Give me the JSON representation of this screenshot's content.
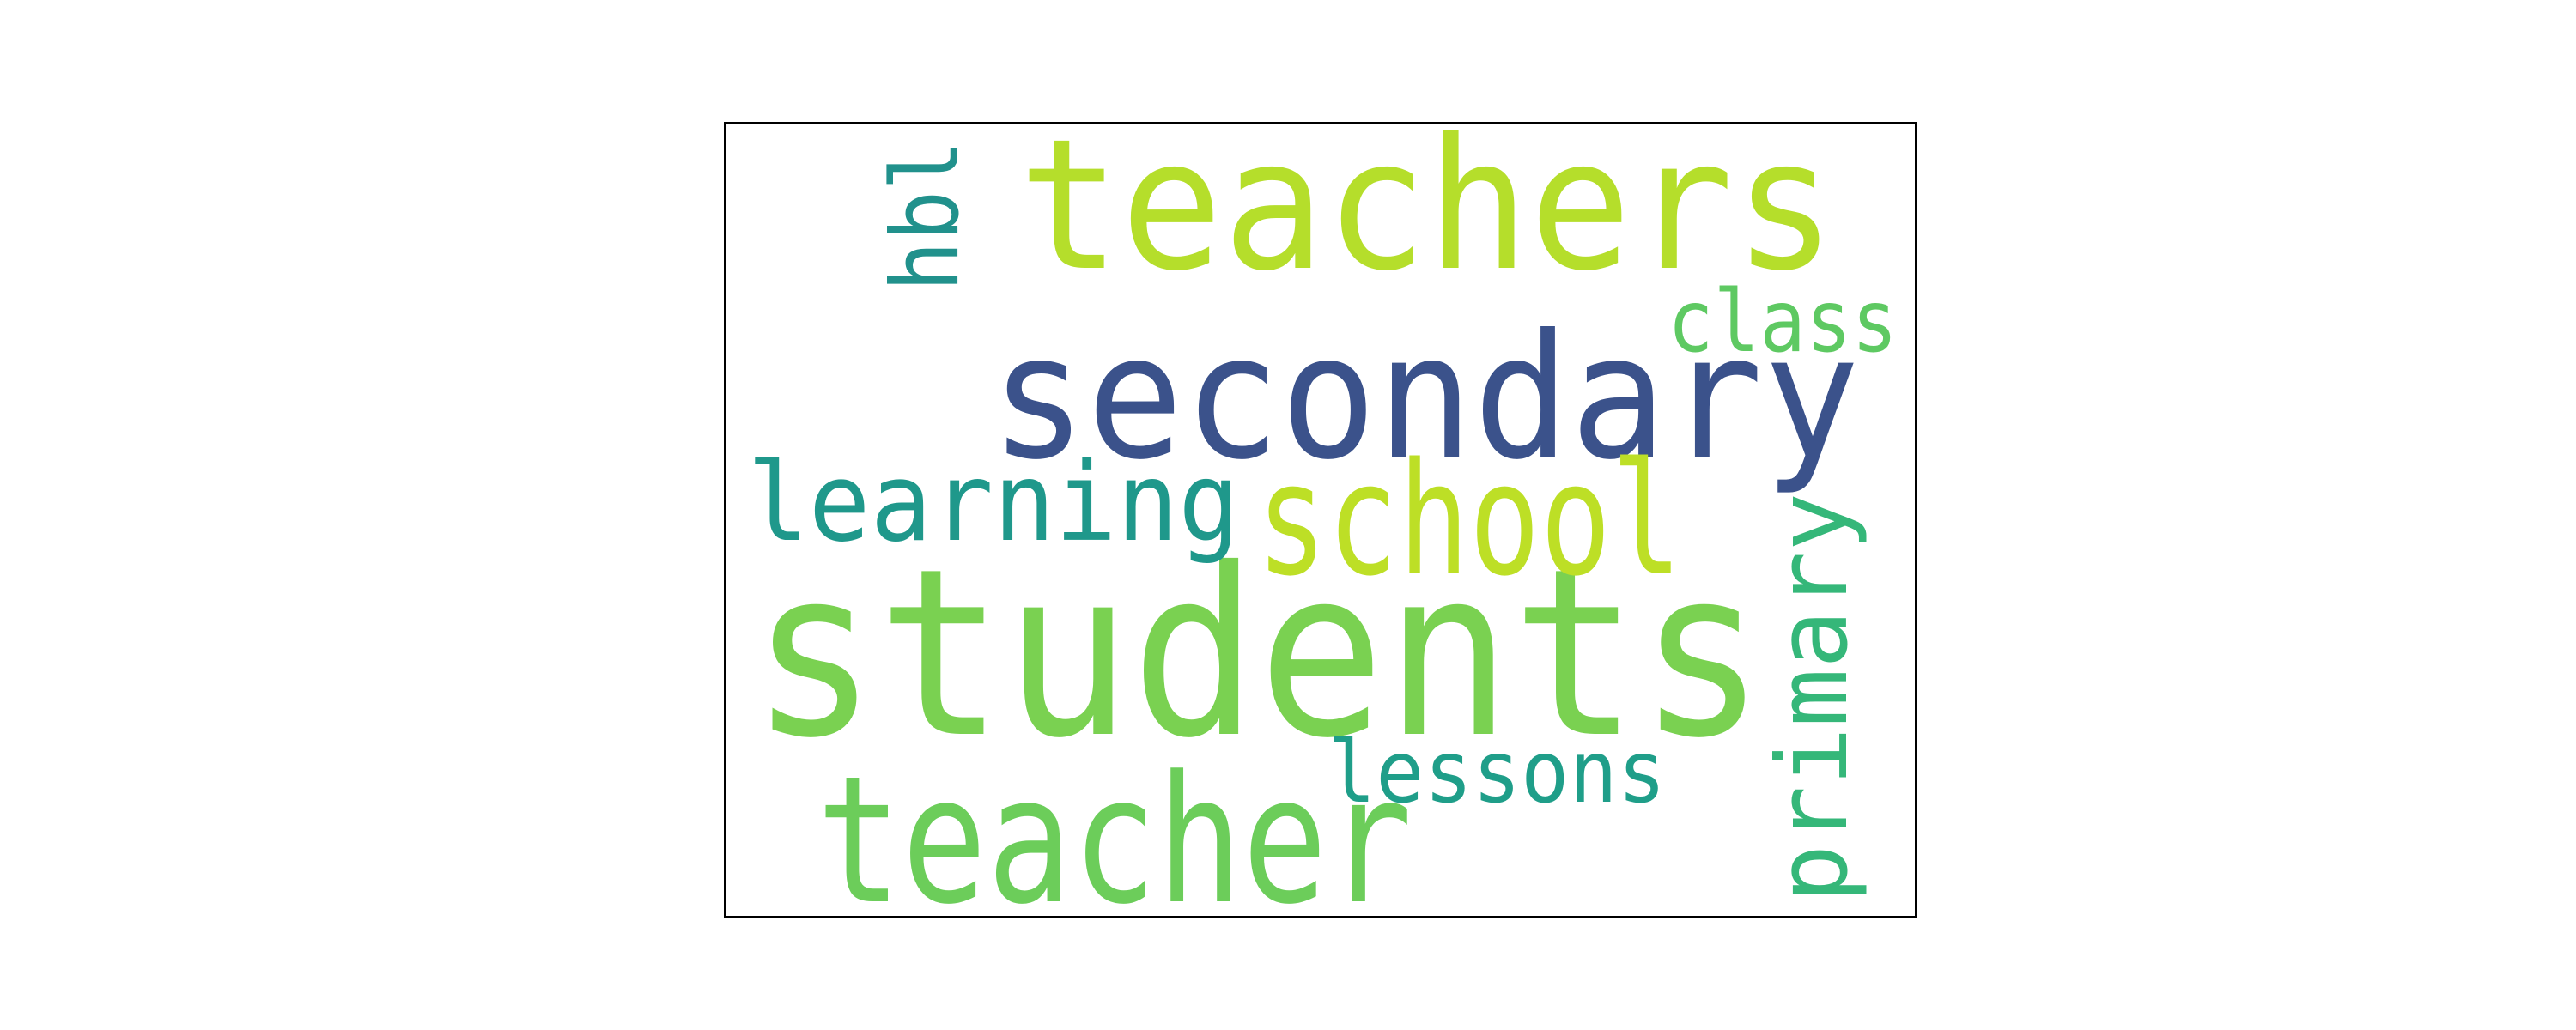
{
  "chart_data": {
    "type": "wordcloud",
    "title": "",
    "words": [
      {
        "text": "students",
        "weight": 1.0,
        "color": "#7ad151",
        "orientation": "horizontal"
      },
      {
        "text": "teachers",
        "weight": 0.78,
        "color": "#b5de2b",
        "orientation": "horizontal"
      },
      {
        "text": "teacher",
        "weight": 0.76,
        "color": "#6ccd5a",
        "orientation": "horizontal"
      },
      {
        "text": "secondary",
        "weight": 0.74,
        "color": "#3b528b",
        "orientation": "horizontal"
      },
      {
        "text": "school",
        "weight": 0.67,
        "color": "#bddf26",
        "orientation": "horizontal"
      },
      {
        "text": "learning",
        "weight": 0.47,
        "color": "#1f988b",
        "orientation": "horizontal"
      },
      {
        "text": "primary",
        "weight": 0.42,
        "color": "#35b779",
        "orientation": "vertical"
      },
      {
        "text": "hbl",
        "weight": 0.4,
        "color": "#21918c",
        "orientation": "vertical"
      },
      {
        "text": "class",
        "weight": 0.37,
        "color": "#5ec962",
        "orientation": "horizontal"
      },
      {
        "text": "lessons",
        "weight": 0.37,
        "color": "#1f9e89",
        "orientation": "horizontal"
      }
    ],
    "background": "#ffffff",
    "frame_color": "#000000"
  }
}
